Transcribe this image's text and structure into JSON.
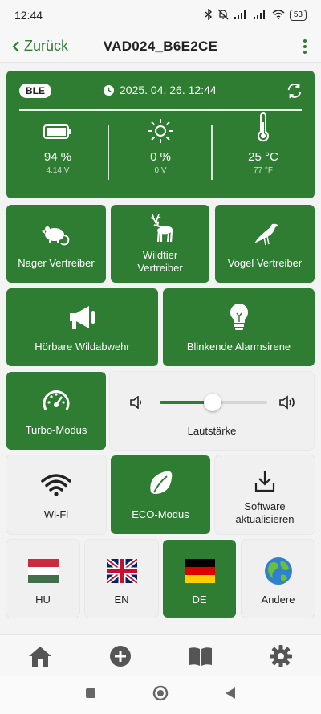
{
  "statusbar": {
    "time": "12:44",
    "battery": "53"
  },
  "appbar": {
    "back_label": "Zurück",
    "title": "VAD024_B6E2CE"
  },
  "device": {
    "ble_label": "BLE",
    "datetime": "2025. 04. 26. 12:44",
    "battery_value": "94 %",
    "battery_sub": "4.14 V",
    "light_value": "0 %",
    "light_sub": "0 V",
    "temp_value": "25 °C",
    "temp_sub": "77 °F"
  },
  "modes": {
    "rodent": "Nager Vertreiber",
    "wildlife_l1": "Wildtier",
    "wildlife_l2": "Vertreiber",
    "bird": "Vogel Vertreiber",
    "audible": "Hörbare Wildabwehr",
    "flashing": "Blinkende Alarmsirene",
    "turbo": "Turbo-Modus"
  },
  "volume": {
    "label": "Lautstärke",
    "level_fraction": 0.49
  },
  "settings": {
    "wifi": "Wi-Fi",
    "eco": "ECO-Modus",
    "update_l1": "Software",
    "update_l2": "aktualisieren"
  },
  "languages": {
    "hu": "HU",
    "en": "EN",
    "de": "DE",
    "other": "Andere"
  },
  "colors": {
    "accent": "#2e7d32",
    "tile_light": "#f0f0f0"
  }
}
